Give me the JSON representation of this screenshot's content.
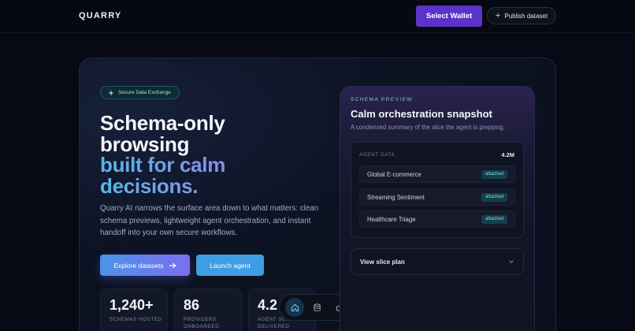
{
  "header": {
    "brand": "QUARRY",
    "wallet_label": "Select Wallet",
    "publish_label": "Publish dataset",
    "publish_icon": "plus-icon"
  },
  "hero": {
    "badge": "Secure Data Exchange",
    "badge_icon": "sparkle-icon",
    "headline": [
      "Schema-only",
      "browsing",
      "built for calm",
      "decisions."
    ],
    "lead": "Quarry AI narrows the surface area down to what matters: clean schema previews, lightweight agent orchestration, and instant handoff into your own secure workflows.",
    "cta_primary": "Explore datasets",
    "cta_primary_icon": "arrow-right-icon",
    "cta_secondary": "Launch agent",
    "stats": [
      {
        "value": "1,240+",
        "label": "SCHEMAS HOSTED"
      },
      {
        "value": "86",
        "label": "PROVIDERS ONBOARDED"
      },
      {
        "value": "4.2",
        "label": "AGENT SL... DELIVERED"
      }
    ]
  },
  "dock": {
    "items": [
      {
        "icon": "home-icon",
        "active": true
      },
      {
        "icon": "database-icon",
        "active": false
      },
      {
        "icon": "robot-icon",
        "active": false
      }
    ]
  },
  "preview": {
    "eyebrow": "SCHEMA PREVIEW",
    "title": "Calm orchestration snapshot",
    "subtitle": "A condensed summary of the slice the agent is prepping.",
    "agent_header": "AGENT DATA",
    "agent_value": "4.2M",
    "rows": [
      {
        "label": "Global E-commerce",
        "tag": "attached"
      },
      {
        "label": "Streaming Sentiment",
        "tag": "attached"
      },
      {
        "label": "Healthcare Triage",
        "tag": "attached"
      }
    ],
    "slice_label": "View slice plan"
  },
  "colors": {
    "accent": "#5b33c8",
    "gradient_start": "#57b8e8",
    "gradient_end": "#8f8ae8",
    "tag_text": "#7fdce4"
  }
}
